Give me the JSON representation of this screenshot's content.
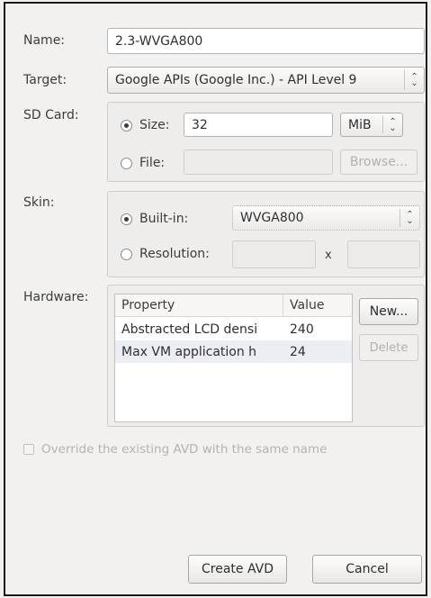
{
  "form": {
    "name_label": "Name:",
    "name_value": "2.3-WVGA800",
    "target_label": "Target:",
    "target_value": "Google APIs (Google Inc.) - API Level 9",
    "sdcard_label": "SD Card:",
    "size_label": "Size:",
    "size_value": "32",
    "size_unit": "MiB",
    "file_label": "File:",
    "file_value": "",
    "browse_label": "Browse...",
    "skin_label": "Skin:",
    "builtin_label": "Built-in:",
    "builtin_value": "WVGA800",
    "resolution_label": "Resolution:",
    "resolution_x": "x",
    "hardware_label": "Hardware:",
    "override_label": "Override the existing AVD with the same name"
  },
  "hardware_table": {
    "headers": [
      "Property",
      "Value"
    ],
    "rows": [
      {
        "property": "Abstracted LCD densi",
        "value": "240"
      },
      {
        "property": "Max VM application h",
        "value": "24"
      }
    ],
    "new_label": "New...",
    "delete_label": "Delete"
  },
  "footer": {
    "create_label": "Create AVD",
    "cancel_label": "Cancel"
  }
}
